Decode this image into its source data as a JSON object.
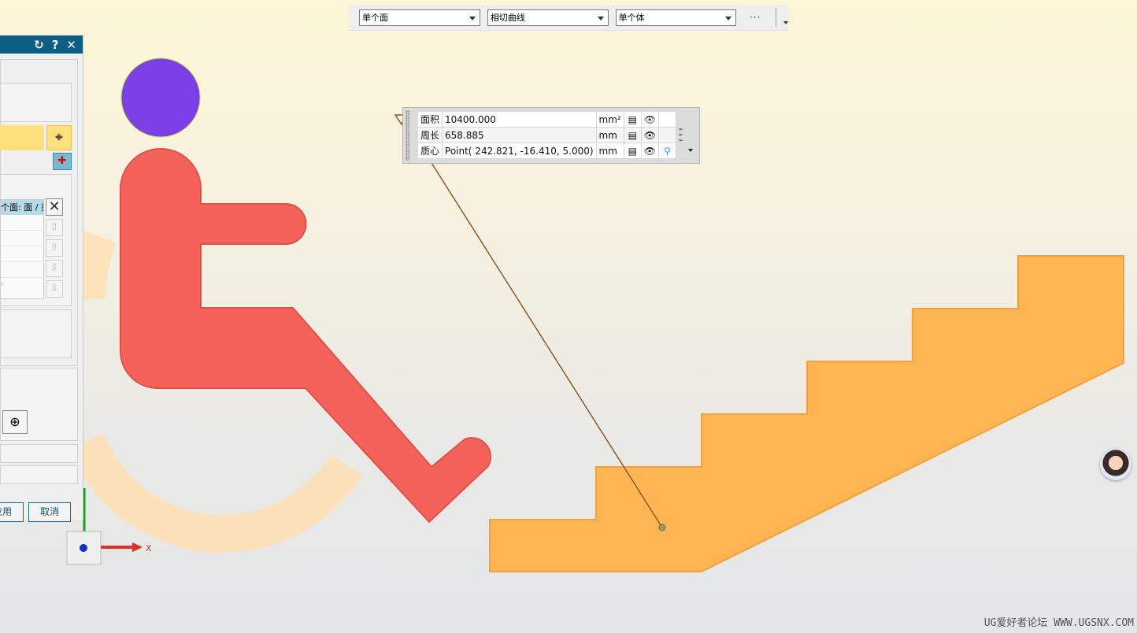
{
  "toolbar": {
    "filter1": "单个面",
    "filter2": "相切曲线",
    "filter3": "单个体",
    "more": "···"
  },
  "measure": {
    "rows": [
      {
        "label": "面积",
        "value": "10400.000",
        "unit": "mm²"
      },
      {
        "label": "周长",
        "value": "658.885",
        "unit": "mm"
      },
      {
        "label": "质心",
        "value": "Point( 242.821, -16.410, 5.000)",
        "unit": "mm"
      }
    ]
  },
  "panel": {
    "header_icons": [
      "reset-icon",
      "help-icon",
      "close-icon"
    ],
    "list_header": "个面: 面 / 扌",
    "list_last": ".",
    "apply": "应用",
    "cancel": "取消"
  },
  "axis": {
    "x_label": "X"
  },
  "watermark": "UG爱好者论坛 WWW.UGSNX.COM",
  "colors": {
    "head": "#7b3fe8",
    "body": "#f4625a",
    "wheel": "#fde2b8",
    "stairs": "#ffb552",
    "leader": "#8b5a2b",
    "panel_header": "#0b5f85"
  }
}
